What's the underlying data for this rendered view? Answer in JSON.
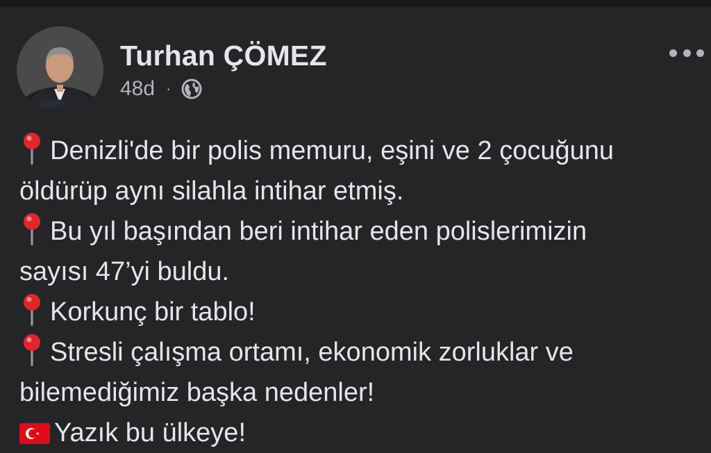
{
  "post": {
    "author": "Turhan ÇÖMEZ",
    "time": "48d",
    "separator": "·",
    "privacy_icon": "globe-icon",
    "menu_icon": "more-horizontal-icon",
    "lines": [
      {
        "prefix_icon": "round-pushpin-icon",
        "text": "Denizli'de bir polis memuru, eşini ve 2 çocuğunu"
      },
      {
        "prefix_icon": "",
        "text": "öldürüp aynı silahla intihar etmiş."
      },
      {
        "prefix_icon": "round-pushpin-icon",
        "text": "Bu yıl başından beri intihar eden polislerimizin"
      },
      {
        "prefix_icon": "",
        "text": "sayısı 47’yi buldu."
      },
      {
        "prefix_icon": "round-pushpin-icon",
        "text": "Korkunç bir tablo!"
      },
      {
        "prefix_icon": "round-pushpin-icon",
        "text": "Stresli çalışma ortamı, ekonomik zorluklar ve"
      },
      {
        "prefix_icon": "",
        "text": "bilemediğimiz başka nedenler!"
      },
      {
        "prefix_icon": "turkey-flag-icon",
        "text": "Yazık bu ülkeye!"
      }
    ]
  },
  "colors": {
    "background": "#242526",
    "text_primary": "#e4e6eb",
    "text_secondary": "#b0b3b8",
    "pin_red": "#e0262b",
    "flag_red": "#e30a17"
  }
}
